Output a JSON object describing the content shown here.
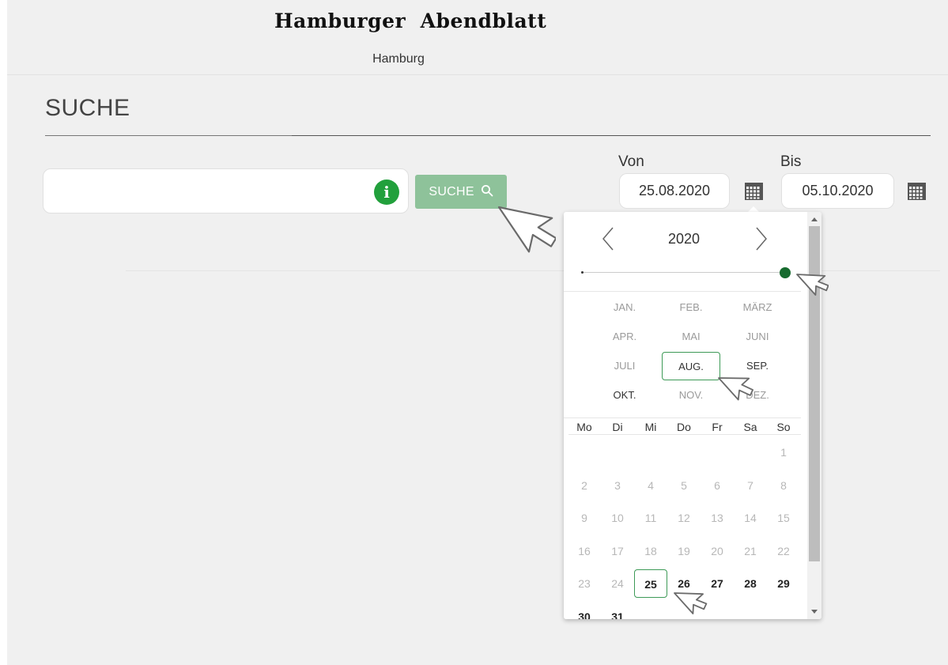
{
  "header": {
    "logo_text": "Hamburger  Abendblatt",
    "city": "Hamburg"
  },
  "section": {
    "title": "SUCHE"
  },
  "search": {
    "input_value": "",
    "button_label": "SUCHE"
  },
  "dates": {
    "from_label": "Von",
    "from_value": "25.08.2020",
    "to_label": "Bis",
    "to_value": "05.10.2020"
  },
  "picker": {
    "year": "2020",
    "months": [
      "JAN.",
      "FEB.",
      "MÄRZ",
      "APR.",
      "MAI",
      "JUNI",
      "JULI",
      "AUG.",
      "SEP.",
      "OKT.",
      "NOV.",
      "DEZ."
    ],
    "selected_month": "AUG.",
    "weekdays": [
      "Mo",
      "Di",
      "Mi",
      "Do",
      "Fr",
      "Sa",
      "So"
    ],
    "days": [
      "1",
      "2",
      "3",
      "4",
      "5",
      "6",
      "7",
      "8",
      "9",
      "10",
      "11",
      "12",
      "13",
      "14",
      "15",
      "16",
      "17",
      "18",
      "19",
      "20",
      "21",
      "22",
      "23",
      "24",
      "25",
      "26",
      "27",
      "28",
      "29",
      "30",
      "31"
    ],
    "selected_day": "25"
  },
  "colors": {
    "accent": "#3d9a57",
    "button": "#8ec29a",
    "info": "#22a03c",
    "slider_thumb": "#176b2f"
  }
}
